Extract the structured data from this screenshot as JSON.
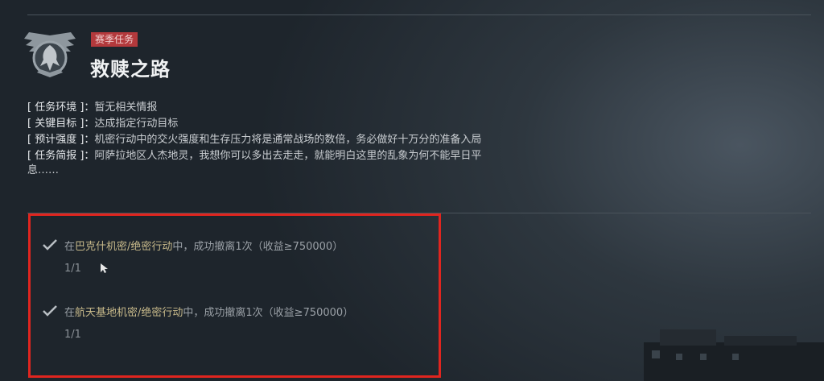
{
  "header": {
    "tag": "赛季任务",
    "title": "救赎之路"
  },
  "info": [
    {
      "key": "[ 任务环境 ]：",
      "value": "暂无相关情报"
    },
    {
      "key": "[ 关键目标 ]：",
      "value": "达成指定行动目标"
    },
    {
      "key": "[ 预计强度 ]：",
      "value": "机密行动中的交火强度和生存压力将是通常战场的数倍，务必做好十万分的准备入局"
    },
    {
      "key": "[ 任务简报 ]：",
      "value": "阿萨拉地区人杰地灵，我想你可以多出去走走，就能明白这里的乱象为何不能早日平",
      "continuation": "息……"
    }
  ],
  "objectives": [
    {
      "prefix": "在",
      "place": "巴克什机密/绝密行动",
      "suffix": "中，成功撤离1次（收益≥750000）",
      "progress": "1/1"
    },
    {
      "prefix": "在",
      "place": "航天基地机密/绝密行动",
      "suffix": "中，成功撤离1次（收益≥750000）",
      "progress": "1/1"
    }
  ],
  "colors": {
    "tag_bg": "#b3393c",
    "highlight_border": "#e0251f",
    "place_text": "#c7b98a"
  },
  "icons": {
    "emblem": "winged-eagle-emblem-icon",
    "complete": "checkmark-icon"
  }
}
